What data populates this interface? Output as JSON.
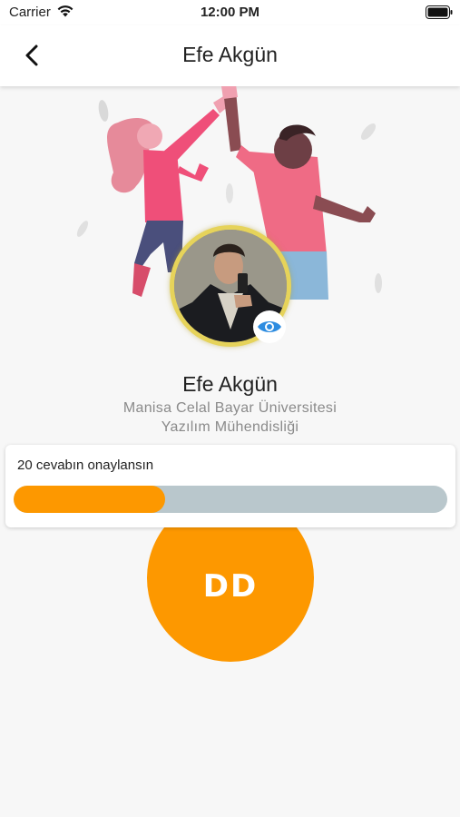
{
  "status_bar": {
    "carrier": "Carrier",
    "time": "12:00 PM",
    "icons": [
      "wifi-icon",
      "battery-icon"
    ]
  },
  "nav": {
    "title": "Efe Akgün",
    "back_icon": "chevron-left-icon"
  },
  "profile": {
    "name": "Efe Akgün",
    "university": "Manisa Celal Bayar Üniversitesi",
    "department": "Yazılım Mühendisliği",
    "avatar_ring_color": "#e6d35a",
    "view_icon": "eye-icon"
  },
  "progress": {
    "label": "20 cevabın onaylansın",
    "fraction": 0.35,
    "fill_color": "#fd9800",
    "track_color": "#b9c7cc"
  },
  "badge": {
    "initials": "DD",
    "color": "#fd9800"
  }
}
